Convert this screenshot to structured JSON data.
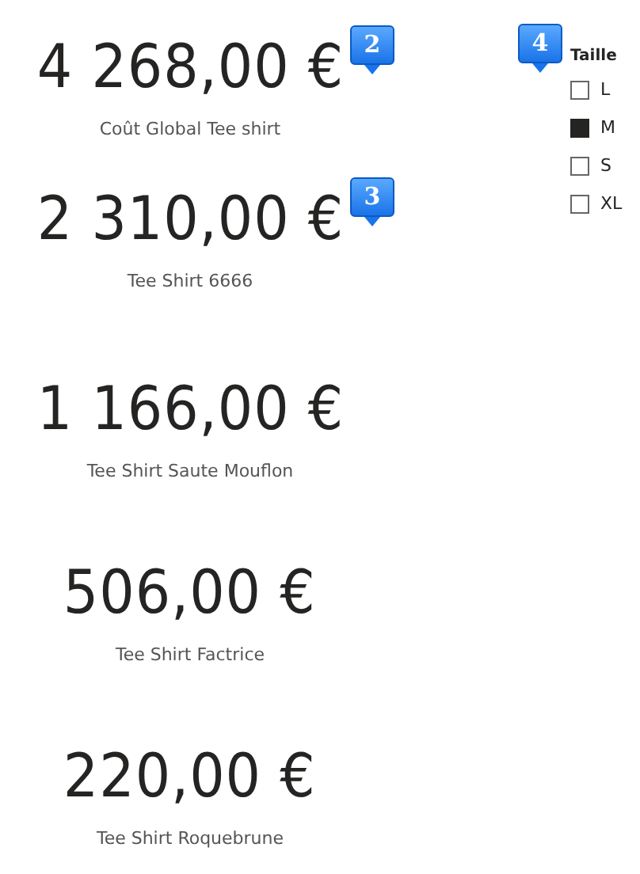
{
  "cards": [
    {
      "value": "4 268,00 €",
      "label": "Coût Global Tee shirt",
      "marker": "2"
    },
    {
      "value": "2 310,00 €",
      "label": "Tee Shirt 6666",
      "marker": "3"
    },
    {
      "value": "1 166,00 €",
      "label": "Tee Shirt Saute Mouflon"
    },
    {
      "value": "506,00 €",
      "label": "Tee Shirt Factrice"
    },
    {
      "value": "220,00 €",
      "label": "Tee Shirt Roquebrune"
    }
  ],
  "slicer": {
    "marker": "4",
    "title": "Taille",
    "items": [
      {
        "label": "L",
        "checked": false
      },
      {
        "label": "M",
        "checked": true
      },
      {
        "label": "S",
        "checked": false
      },
      {
        "label": "XL",
        "checked": false
      }
    ]
  }
}
